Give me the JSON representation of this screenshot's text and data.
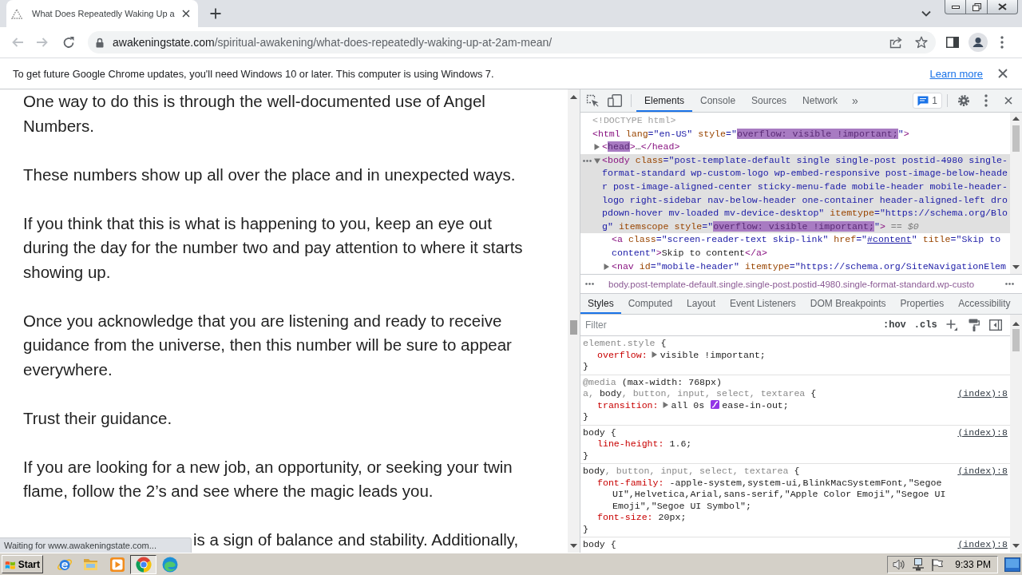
{
  "tabs": [
    {
      "title": "What Does Repeatedly Waking Up a",
      "selected": true
    }
  ],
  "toolbar": {
    "back": {
      "disabled": true
    },
    "forward": {
      "disabled": true
    },
    "url": {
      "host": "awakeningstate.com",
      "path": "/spiritual-awakening/what-does-repeatedly-waking-up-at-2am-mean/"
    }
  },
  "infobar": {
    "message": "To get future Google Chrome updates, you'll need Windows 10 or later. This computer is using Windows 7.",
    "link": "Learn more"
  },
  "page": {
    "paragraphs": [
      {
        "kind": "full",
        "text": "One way to do this is through the well-documented use of Angel Numbers."
      },
      {
        "kind": "full",
        "text": "These numbers show up all over the place and in unexpected ways."
      },
      {
        "kind": "full",
        "text": "If you think that this is what is happening to you, keep an eye out during the day for the number two and pay attention to where it starts showing up."
      },
      {
        "kind": "full",
        "text": "Once you acknowledge that you are listening and ready to receive guidance from the universe, then this number will be sure to appear everywhere."
      },
      {
        "kind": "full",
        "text": "Trust their guidance."
      },
      {
        "kind": "full",
        "text": "If you are looking for a new job, an opportunity, or seeking your twin flame, follow the 2’s and see where the magic leads you."
      },
      {
        "kind": "covered",
        "text": "is a sign of balance and stability. Additionally,"
      }
    ],
    "status": "Waiting for www.awakeningstate.com..."
  },
  "devtools": {
    "tabs": [
      {
        "label": "Elements",
        "selected": true
      },
      {
        "label": "Console",
        "selected": false
      },
      {
        "label": "Sources",
        "selected": false
      },
      {
        "label": "Network",
        "selected": false
      }
    ],
    "more_tabs": "»",
    "issues_count": "1",
    "dom_tree": [
      {
        "selected": false,
        "parts": [
          {
            "kind": "doctype",
            "text": "<!DOCTYPE html>"
          }
        ]
      },
      {
        "selected": false,
        "parts": [
          {
            "kind": "tag",
            "text": "<html"
          },
          {
            "kind": "attr",
            "text": " lang"
          },
          {
            "kind": "value",
            "text": "=\"en-US\""
          },
          {
            "kind": "attr",
            "text": " style"
          },
          {
            "kind": "value",
            "text": "=\""
          },
          {
            "kind": "match",
            "text": "overflow: visible !important;"
          },
          {
            "kind": "value",
            "text": "\""
          },
          {
            "kind": "tag",
            "text": ">"
          }
        ],
        "children": [
          {
            "selected": false,
            "expanded": false,
            "parts": [
              {
                "kind": "tag",
                "text": "<"
              },
              {
                "kind": "match",
                "text": "head"
              },
              {
                "kind": "tag",
                "text": ">"
              },
              {
                "kind": "text",
                "text": "…"
              },
              {
                "kind": "tag",
                "text": "</head>"
              }
            ]
          },
          {
            "selected": true,
            "expanded": true,
            "parts": [
              {
                "kind": "tag",
                "text": "<body"
              },
              {
                "kind": "attr",
                "text": " class"
              },
              {
                "kind": "value",
                "text": "=\"post-template-default single single-post postid-4980 single-format-standard wp-custom-logo wp-embed-responsive post-image-below-header post-image-aligned-center sticky-menu-fade mobile-header mobile-header-logo right-sidebar nav-below-header one-container header-aligned-left dropdown-hover mv-loaded mv-device-desktop\""
              },
              {
                "kind": "attr",
                "text": " itemtype"
              },
              {
                "kind": "value",
                "text": "=\"https://schema.org/Blog\""
              },
              {
                "kind": "attr",
                "text": " itemscope"
              },
              {
                "kind": "attr",
                "text": " style"
              },
              {
                "kind": "value",
                "text": "=\""
              },
              {
                "kind": "match",
                "text": "overflow: visible !important;"
              },
              {
                "kind": "value",
                "text": "\""
              },
              {
                "kind": "tag",
                "text": ">"
              },
              {
                "kind": "ref",
                "text": " == $0"
              }
            ],
            "children": [
              {
                "selected": false,
                "parts": [
                  {
                    "kind": "tag",
                    "text": "<a"
                  },
                  {
                    "kind": "attr",
                    "text": " class"
                  },
                  {
                    "kind": "value",
                    "text": "=\"screen-reader-text skip-link\""
                  },
                  {
                    "kind": "attr",
                    "text": " href"
                  },
                  {
                    "kind": "value",
                    "text": "=\""
                  },
                  {
                    "kind": "link",
                    "text": "#content"
                  },
                  {
                    "kind": "value",
                    "text": "\""
                  },
                  {
                    "kind": "attr",
                    "text": " title"
                  },
                  {
                    "kind": "value",
                    "text": "=\"Skip to content\""
                  },
                  {
                    "kind": "tag",
                    "text": ">"
                  },
                  {
                    "kind": "text",
                    "text": "Skip to content"
                  },
                  {
                    "kind": "tag",
                    "text": "</a>"
                  }
                ]
              },
              {
                "selected": false,
                "expanded": false,
                "parts": [
                  {
                    "kind": "tag",
                    "text": "<nav"
                  },
                  {
                    "kind": "attr",
                    "text": " id"
                  },
                  {
                    "kind": "value",
                    "text": "=\"mobile-header\""
                  },
                  {
                    "kind": "attr",
                    "text": " itemtype"
                  },
                  {
                    "kind": "value",
                    "text": "=\"https://schema.org/SiteNavigationElem"
                  }
                ]
              }
            ]
          }
        ]
      }
    ],
    "breadcrumb": "body.post-template-default.single.single-post.postid-4980.single-format-standard.wp-custo",
    "sidebar_tabs": [
      {
        "label": "Styles",
        "selected": true
      },
      {
        "label": "Computed",
        "selected": false
      },
      {
        "label": "Layout",
        "selected": false
      },
      {
        "label": "Event Listeners",
        "selected": false
      },
      {
        "label": "DOM Breakpoints",
        "selected": false
      },
      {
        "label": "Properties",
        "selected": false
      },
      {
        "label": "Accessibility",
        "selected": false
      }
    ],
    "filter": {
      "placeholder": "Filter"
    },
    "filter_toggles": [
      ":hov",
      ".cls"
    ],
    "rules": [
      {
        "selector": [
          {
            "kind": "dim",
            "text": "element.style"
          },
          {
            "kind": "plain",
            "text": " {"
          }
        ],
        "declarations": [
          {
            "property": "overflow:",
            "expandable": true,
            "value": [
              {
                "kind": "text",
                "text": "visible !important;"
              }
            ]
          }
        ],
        "close": "}"
      },
      {
        "media": [
          {
            "kind": "dim",
            "text": "@media"
          },
          {
            "kind": "plain",
            "text": " (max-width: 768px)"
          }
        ],
        "selector": [
          {
            "kind": "dim",
            "text": "a, "
          },
          {
            "kind": "plain",
            "text": "body"
          },
          {
            "kind": "dim",
            "text": ", button, input, select, textarea"
          },
          {
            "kind": "plain",
            "text": " {"
          }
        ],
        "source": "(index):8",
        "declarations": [
          {
            "property": "transition:",
            "expandable": true,
            "value": [
              {
                "kind": "text",
                "text": "all 0s"
              },
              {
                "kind": "easing"
              },
              {
                "kind": "text",
                "text": "ease-in-out;"
              }
            ]
          }
        ],
        "close": "}"
      },
      {
        "selector": [
          {
            "kind": "plain",
            "text": "body {"
          }
        ],
        "source": "(index):8",
        "declarations": [
          {
            "property": "line-height:",
            "expandable": false,
            "value": [
              {
                "kind": "text",
                "text": "1.6;"
              }
            ]
          }
        ],
        "close": "}"
      },
      {
        "selector": [
          {
            "kind": "plain",
            "text": "body"
          },
          {
            "kind": "dim",
            "text": ", button, input, select, textarea"
          },
          {
            "kind": "plain",
            "text": " {"
          }
        ],
        "source": "(index):8",
        "declarations": [
          {
            "property": "font-family:",
            "expandable": false,
            "value": [
              {
                "kind": "text",
                "text": "-apple-system,system-ui,BlinkMacSystemFont,\"Segoe UI\",Helvetica,Arial,sans-serif,\"Apple Color Emoji\",\"Segoe UI Emoji\",\"Segoe UI Symbol\";"
              }
            ]
          },
          {
            "property": "font-size:",
            "expandable": false,
            "value": [
              {
                "kind": "text",
                "text": "20px;"
              }
            ]
          }
        ],
        "close": "}"
      },
      {
        "selector": [
          {
            "kind": "plain",
            "text": "body {"
          }
        ],
        "source": "(index):8"
      }
    ]
  },
  "taskbar": {
    "start": "Start",
    "apps": [
      {
        "kind": "ie",
        "selected": false
      },
      {
        "kind": "folder",
        "selected": false
      },
      {
        "kind": "media",
        "selected": false
      },
      {
        "kind": "chrome",
        "selected": true
      },
      {
        "kind": "edge",
        "selected": false
      }
    ],
    "clock": "9:33 PM"
  }
}
